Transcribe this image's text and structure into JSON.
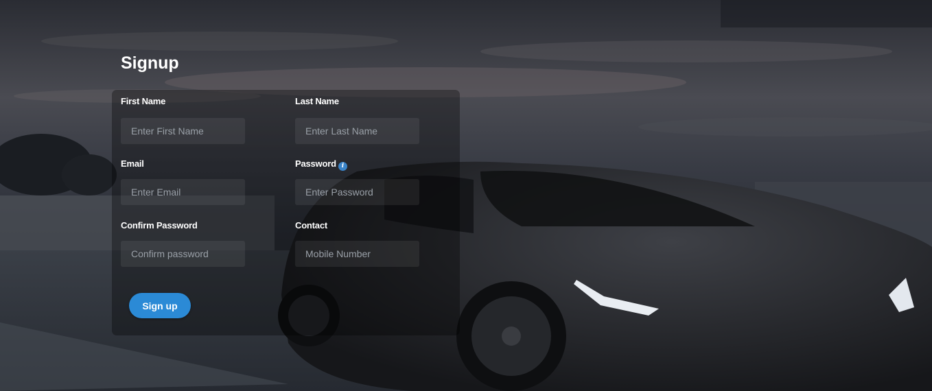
{
  "page": {
    "title": "Signup",
    "background": "sports-car-photo"
  },
  "form": {
    "first_name": {
      "label": "First Name",
      "placeholder": "Enter First Name"
    },
    "last_name": {
      "label": "Last Name",
      "placeholder": "Enter Last Name"
    },
    "email": {
      "label": "Email",
      "placeholder": "Enter Email"
    },
    "password": {
      "label": "Password",
      "placeholder": "Enter Password",
      "icon": "info-icon"
    },
    "confirm_password": {
      "label": "Confirm Password",
      "placeholder": "Confirm password"
    },
    "contact": {
      "label": "Contact",
      "placeholder": "Mobile Number"
    },
    "submit_label": "Sign up"
  },
  "colors": {
    "accent": "#2b8ad6",
    "info_icon": "#3a84c9",
    "text": "#ffffff"
  }
}
